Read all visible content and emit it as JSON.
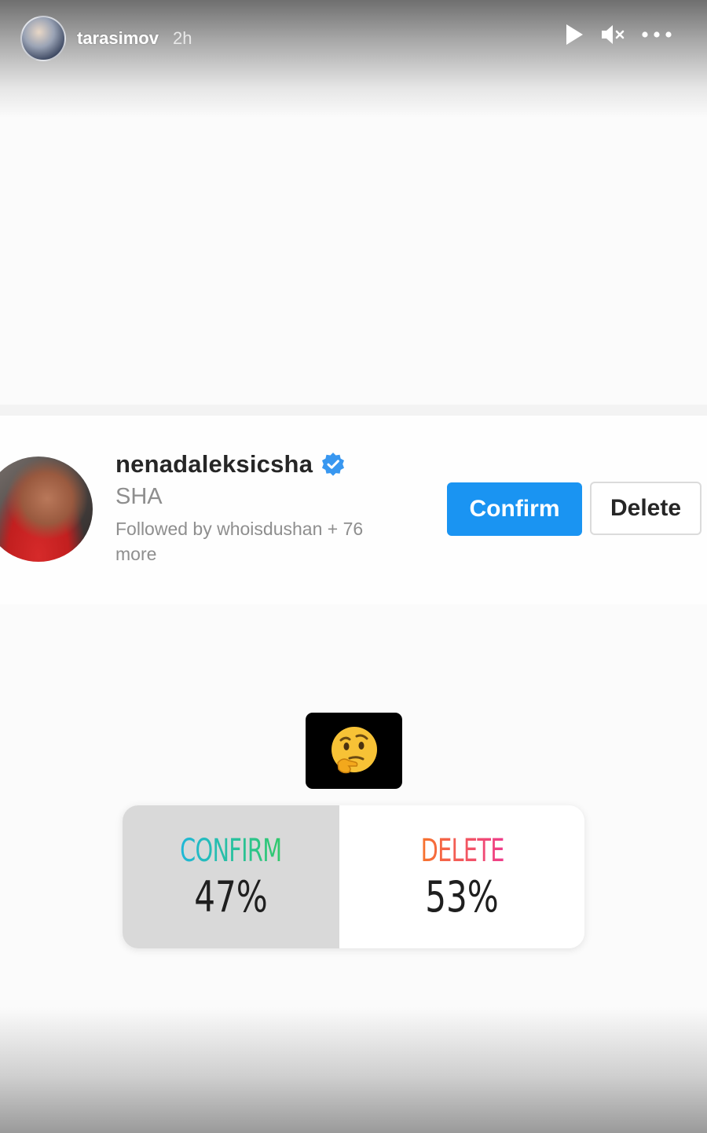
{
  "header": {
    "username": "tarasimov",
    "time_ago": "2h",
    "controls": {
      "play_icon": "play-icon",
      "mute_icon": "volume-muted-icon",
      "more_icon": "more-options-icon"
    }
  },
  "profile": {
    "username": "nenadaleksicsha",
    "verified": true,
    "full_name": "SHA",
    "followed_by": "Followed by whoisdushan + 76 more",
    "confirm_label": "Confirm",
    "delete_label": "Delete"
  },
  "emoji_sticker": {
    "icon": "thinking-face-icon",
    "emoji": "🤔"
  },
  "poll": {
    "options": [
      {
        "label": "CONFIRM",
        "percent_text": "47%",
        "percent": 47
      },
      {
        "label": "DELETE",
        "percent_text": "53%",
        "percent": 53
      }
    ]
  },
  "colors": {
    "confirm_button": "#1a94f2",
    "verified_badge": "#3897f0",
    "confirm_gradient": [
      "#1fb7d8",
      "#31c96b"
    ],
    "delete_gradient": [
      "#f7742c",
      "#ee3d8c"
    ]
  }
}
